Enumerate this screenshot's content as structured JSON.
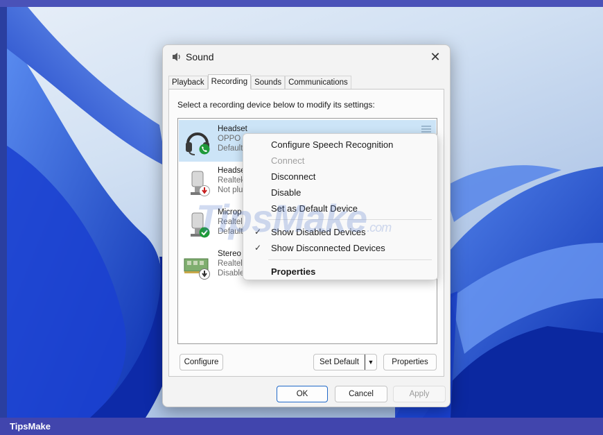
{
  "window": {
    "title": "Sound",
    "close_glyph": "✕"
  },
  "tabs": [
    {
      "label": "Playback",
      "active": false
    },
    {
      "label": "Recording",
      "active": true
    },
    {
      "label": "Sounds",
      "active": false
    },
    {
      "label": "Communications",
      "active": false
    }
  ],
  "instruction": "Select a recording device below to modify its settings:",
  "devices": [
    {
      "name": "Headset",
      "line2": "OPPO I",
      "line3": "Default",
      "icon": "headset-icon",
      "status_icon": "phone-badge-icon",
      "selected": true
    },
    {
      "name": "Headse",
      "line2": "Realtek",
      "line3": "Not plu",
      "icon": "microphone-icon",
      "status_icon": "unplugged-badge-icon",
      "selected": false
    },
    {
      "name": "Microp",
      "line2": "Realtel",
      "line3": "Default",
      "icon": "microphone-icon",
      "status_icon": "check-badge-icon",
      "selected": false
    },
    {
      "name": "Stereo",
      "line2": "Realtel",
      "line3": "Disable",
      "icon": "soundcard-icon",
      "status_icon": "disabled-badge-icon",
      "selected": false
    }
  ],
  "buttons": {
    "configure": "Configure",
    "set_default": "Set Default",
    "properties": "Properties",
    "ok": "OK",
    "cancel": "Cancel",
    "apply": "Apply"
  },
  "context_menu": {
    "items": [
      {
        "label": "Configure Speech Recognition",
        "disabled": false,
        "checked": false,
        "bold": false
      },
      {
        "label": "Connect",
        "disabled": true,
        "checked": false,
        "bold": false
      },
      {
        "label": "Disconnect",
        "disabled": false,
        "checked": false,
        "bold": false
      },
      {
        "label": "Disable",
        "disabled": false,
        "checked": false,
        "bold": false
      },
      {
        "label": "Set as Default Device",
        "disabled": false,
        "checked": false,
        "bold": false
      },
      {
        "label": "Show Disabled Devices",
        "disabled": false,
        "checked": true,
        "bold": false
      },
      {
        "label": "Show Disconnected Devices",
        "disabled": false,
        "checked": true,
        "bold": false
      },
      {
        "label": "Properties",
        "disabled": false,
        "checked": false,
        "bold": true
      }
    ],
    "check_glyph": "✓"
  },
  "watermark": {
    "main": "TipsMake",
    "suffix": ".com"
  },
  "footer": {
    "brand": "TipsMake"
  },
  "colors": {
    "selection": "#cce4f7",
    "accent": "#2068c8",
    "wallpaper_blue": "#1f4fd8",
    "brand_bar": "#4145ad"
  }
}
